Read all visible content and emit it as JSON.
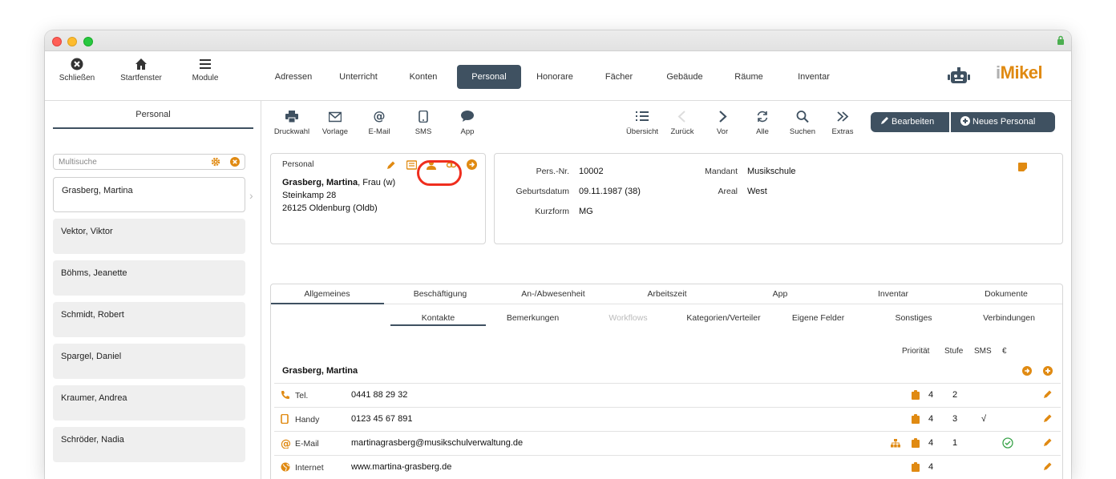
{
  "toolbar": {
    "close_label": "Schließen",
    "home_label": "Startfenster",
    "modules_label": "Module"
  },
  "tabs": [
    {
      "label": "Adressen"
    },
    {
      "label": "Unterricht"
    },
    {
      "label": "Konten"
    },
    {
      "label": "Personal"
    },
    {
      "label": "Honorare"
    },
    {
      "label": "Fächer"
    },
    {
      "label": "Gebäude"
    },
    {
      "label": "Räume"
    },
    {
      "label": "Inventar"
    }
  ],
  "logo": {
    "i": "i",
    "rest": "Mikel"
  },
  "sidebar": {
    "title": "Personal",
    "search_placeholder": "Multisuche",
    "items": [
      {
        "name": "Grasberg, Martina"
      },
      {
        "name": "Vektor, Viktor"
      },
      {
        "name": "Böhms, Jeanette"
      },
      {
        "name": "Schmidt, Robert"
      },
      {
        "name": "Spargel, Daniel"
      },
      {
        "name": "Kraumer, Andrea"
      },
      {
        "name": "Schröder, Nadia"
      }
    ]
  },
  "actions": {
    "print": "Druckwahl",
    "template": "Vorlage",
    "email": "E-Mail",
    "sms": "SMS",
    "app": "App",
    "overview": "Übersicht",
    "back": "Zurück",
    "forward": "Vor",
    "all": "Alle",
    "search": "Suchen",
    "extras": "Extras",
    "edit": "Bearbeiten",
    "new": "Neues Personal"
  },
  "person_card": {
    "label": "Personal",
    "name_bold": "Grasberg, Martina",
    "name_rest": ", Frau (w)",
    "street": "Steinkamp 28",
    "city": "26125 Oldenburg (Oldb)"
  },
  "info_card": {
    "persnr_label": "Pers.-Nr.",
    "persnr": "10002",
    "birth_label": "Geburtsdatum",
    "birth": "09.11.1987 (38)",
    "short_label": "Kurzform",
    "short": "MG",
    "client_label": "Mandant",
    "client": "Musikschule",
    "area_label": "Areal",
    "area": "West"
  },
  "detail_tabs": [
    {
      "label": "Allgemeines"
    },
    {
      "label": "Beschäftigung"
    },
    {
      "label": "An-/Abwesenheit"
    },
    {
      "label": "Arbeitszeit"
    },
    {
      "label": "App"
    },
    {
      "label": "Inventar"
    },
    {
      "label": "Dokumente"
    }
  ],
  "sub_tabs": [
    {
      "label": "Kontakte"
    },
    {
      "label": "Bemerkungen"
    },
    {
      "label": "Workflows"
    },
    {
      "label": "Kategorien/Verteiler"
    },
    {
      "label": "Eigene Felder"
    },
    {
      "label": "Sonstiges"
    },
    {
      "label": "Verbindungen"
    }
  ],
  "contacts": {
    "headers": {
      "priority": "Priorität",
      "level": "Stufe",
      "sms": "SMS",
      "euro": "€"
    },
    "person": "Grasberg, Martina",
    "rows": [
      {
        "type": "Tel.",
        "value": "0441 88 29 32",
        "priority": "4",
        "level": "2",
        "sms": ""
      },
      {
        "type": "Handy",
        "value": "0123 45 67 891",
        "priority": "4",
        "level": "3",
        "sms": "√"
      },
      {
        "type": "E-Mail",
        "value": "martinagrasberg@musikschulverwaltung.de",
        "priority": "4",
        "level": "1",
        "sms": ""
      },
      {
        "type": "Internet",
        "value": "www.martina-grasberg.de",
        "priority": "4",
        "level": "",
        "sms": ""
      }
    ]
  },
  "colors": {
    "accent": "#e08a12",
    "dark": "#3f5161",
    "highlight": "#ef2e1e",
    "ok": "#3aa34a"
  }
}
